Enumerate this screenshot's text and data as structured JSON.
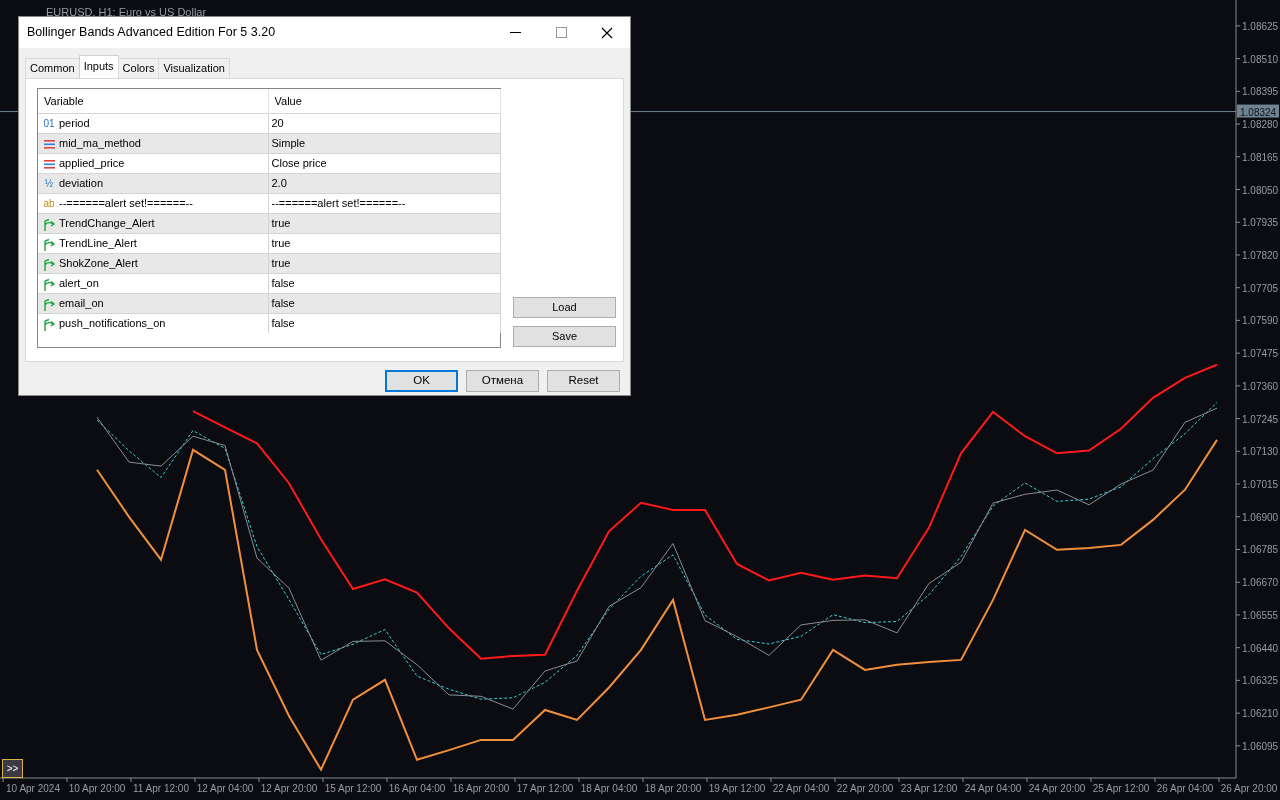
{
  "chart": {
    "title": "EURUSD, H1: Euro vs US Dollar",
    "expand_button": ">>",
    "chart_data": {
      "type": "line",
      "categories": [
        "10 Apr 2024",
        null,
        "10 Apr 20:00",
        null,
        "11 Apr 12:00",
        null,
        "12 Apr 04:00",
        null,
        "12 Apr 20:00",
        null,
        "15 Apr 12:00",
        null,
        "16 Apr 04:00",
        null,
        "16 Apr 20:00",
        null,
        "17 Apr 12:00",
        null,
        "18 Apr 04:00",
        null,
        "18 Apr 20:00",
        null,
        "19 Apr 12:00",
        null,
        "22 Apr 04:00",
        null,
        "22 Apr 20:00",
        null,
        "23 Apr 12:00",
        null,
        "24 Apr 04:00",
        null,
        "24 Apr 20:00",
        null,
        "25 Apr 12:00",
        null,
        "26 Apr 04:00",
        null,
        "26 Apr 20:00"
      ],
      "series": [
        {
          "color": "#ff1a1a",
          "values": [
            null,
            null,
            null,
            null,
            null,
            1.07271,
            1.07214,
            1.07158,
            1.07018,
            1.06821,
            1.06646,
            1.0668,
            1.06633,
            1.06508,
            1.06401,
            1.06411,
            1.06415,
            1.0664,
            1.06849,
            1.06949,
            1.06924,
            1.06924,
            1.06734,
            1.06676,
            1.06703,
            1.06679,
            1.06694,
            1.06684,
            1.06862,
            1.07123,
            1.07268,
            1.07183,
            1.07123,
            1.07133,
            1.07209,
            1.07318,
            1.07388,
            1.07434,
            null
          ]
        },
        {
          "color": "#f0903c",
          "values": [
            null,
            null,
            1.07065,
            1.069,
            1.06749,
            1.07135,
            1.07065,
            1.06432,
            1.062,
            1.06011,
            1.06257,
            1.06327,
            1.06046,
            1.0608,
            1.06116,
            1.06116,
            1.06221,
            1.06186,
            1.063,
            1.06432,
            1.06608,
            1.06186,
            1.06204,
            1.0623,
            1.06257,
            1.06432,
            1.06362,
            1.0638,
            1.0639,
            1.06397,
            1.06608,
            1.06854,
            1.06784,
            1.0679,
            1.06801,
            1.06889,
            1.06995,
            1.0717,
            null
          ]
        },
        {
          "color": "#2ed0d0",
          "line_style": "dashed",
          "values": [
            null,
            null,
            1.0724,
            1.07132,
            1.07038,
            1.07203,
            1.0714,
            1.06795,
            1.06609,
            1.06416,
            1.06452,
            1.06504,
            1.0634,
            1.06294,
            1.06259,
            1.06264,
            1.06318,
            1.06413,
            1.06575,
            1.06691,
            1.06766,
            1.06555,
            1.06469,
            1.06453,
            1.0648,
            1.06556,
            1.06528,
            1.06532,
            1.06626,
            1.0676,
            1.06938,
            1.07019,
            1.06954,
            1.06962,
            1.07005,
            1.07104,
            1.07192,
            1.07302,
            null
          ]
        },
        {
          "color": "#8c8c94",
          "values": [
            null,
            null,
            1.0725,
            1.07092,
            1.07078,
            1.07183,
            1.0715,
            1.06755,
            1.06649,
            1.06396,
            1.06462,
            1.06464,
            1.0638,
            1.06274,
            1.06269,
            1.06224,
            1.06358,
            1.06393,
            1.06585,
            1.06651,
            1.06806,
            1.06535,
            1.06479,
            1.06413,
            1.0652,
            1.06536,
            1.06538,
            1.06492,
            1.06666,
            1.0674,
            1.06948,
            1.06979,
            1.06994,
            1.06942,
            1.07015,
            1.07064,
            1.07232,
            1.07282,
            null
          ]
        }
      ],
      "ylim": [
        1.05982,
        1.08716
      ],
      "yticks": [
        {
          "value": 1.08625,
          "label": "1.08625"
        },
        {
          "value": 1.0851,
          "label": "1.08510"
        },
        {
          "value": 1.08395,
          "label": "1.08395"
        },
        {
          "value": 1.0828,
          "label": "1.08280"
        },
        {
          "value": 1.08165,
          "label": "1.08165"
        },
        {
          "value": 1.0805,
          "label": "1.08050"
        },
        {
          "value": 1.07935,
          "label": "1.07935"
        },
        {
          "value": 1.0782,
          "label": "1.07820"
        },
        {
          "value": 1.07705,
          "label": "1.07705"
        },
        {
          "value": 1.0759,
          "label": "1.07590"
        },
        {
          "value": 1.07475,
          "label": "1.07475"
        },
        {
          "value": 1.0736,
          "label": "1.07360"
        },
        {
          "value": 1.07245,
          "label": "1.07245"
        },
        {
          "value": 1.0713,
          "label": "1.07130"
        },
        {
          "value": 1.07015,
          "label": "1.07015"
        },
        {
          "value": 1.069,
          "label": "1.06900"
        },
        {
          "value": 1.06785,
          "label": "1.06785"
        },
        {
          "value": 1.0667,
          "label": "1.06670"
        },
        {
          "value": 1.06555,
          "label": "1.06555"
        },
        {
          "value": 1.0644,
          "label": "1.06440"
        },
        {
          "value": 1.06325,
          "label": "1.06325"
        },
        {
          "value": 1.0621,
          "label": "1.06210"
        },
        {
          "value": 1.06095,
          "label": "1.06095"
        }
      ],
      "ref_lines": [
        {
          "axis": "y",
          "value": 1.08324,
          "label": "1.08324"
        }
      ]
    }
  },
  "dialog": {
    "title": "Bollinger Bands Advanced Edition For 5 3.20",
    "tabs": [
      {
        "label": "Common",
        "selected": false
      },
      {
        "label": "Inputs",
        "selected": true
      },
      {
        "label": "Colors",
        "selected": false
      },
      {
        "label": "Visualization",
        "selected": false
      }
    ],
    "table": {
      "columns": [
        "Variable",
        "Value"
      ],
      "rows": [
        {
          "kind": "int",
          "icon": "01",
          "variable": "period",
          "value": "20"
        },
        {
          "kind": "enum",
          "variable": "mid_ma_method",
          "value": "Simple"
        },
        {
          "kind": "enum",
          "variable": "applied_price",
          "value": "Close price"
        },
        {
          "kind": "double",
          "icon": "½",
          "variable": "deviation",
          "value": "2.0"
        },
        {
          "kind": "string",
          "icon": "ab",
          "variable": "--======alert set!======--",
          "value": "--======alert set!======--"
        },
        {
          "kind": "bool",
          "variable": "TrendChange_Alert",
          "value": "true"
        },
        {
          "kind": "bool",
          "variable": "TrendLine_Alert",
          "value": "true"
        },
        {
          "kind": "bool",
          "variable": "ShokZone_Alert",
          "value": "true"
        },
        {
          "kind": "bool",
          "variable": "alert_on",
          "value": "false"
        },
        {
          "kind": "bool",
          "variable": "email_on",
          "value": "false"
        },
        {
          "kind": "bool",
          "variable": "push_notifications_on",
          "value": "false"
        }
      ]
    },
    "side_buttons": [
      "Load",
      "Save"
    ],
    "buttons": [
      {
        "label": "OK",
        "default": true
      },
      {
        "label": "Отмена",
        "default": false
      },
      {
        "label": "Reset",
        "default": false
      }
    ]
  }
}
